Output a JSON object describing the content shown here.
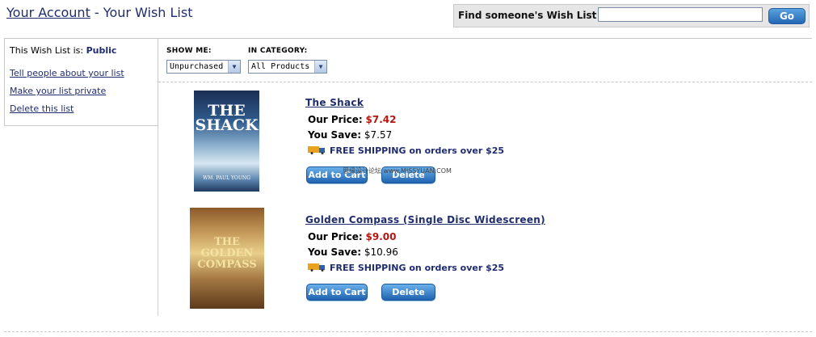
{
  "header": {
    "account_link": "Your Account",
    "separator": " - ",
    "page_title": "Your Wish List",
    "find_label": "Find someone's Wish List",
    "find_input_value": "",
    "go_button": "Go"
  },
  "left_panel": {
    "status_prefix": "This Wish List is:",
    "status_value": "Public",
    "links": [
      "Tell people about your list",
      "Make your list private",
      "Delete this list"
    ]
  },
  "filters": {
    "show_me_label": "SHOW ME:",
    "show_me_value": "Unpurchased",
    "category_label": "IN CATEGORY:",
    "category_value": "All Products"
  },
  "items": [
    {
      "title": "The Shack",
      "our_price_label": "Our Price:",
      "our_price": "$7.42",
      "you_save_label": "You Save:",
      "you_save": "$7.57",
      "shipping": "FREE SHIPPING on orders over $25",
      "add_to_cart": "Add to Cart",
      "delete": "Delete",
      "cover_text": "THE SHACK",
      "cover_author": "WM. PAUL YOUNG"
    },
    {
      "title": "Golden Compass (Single Disc Widescreen)",
      "our_price_label": "Our Price:",
      "our_price": "$9.00",
      "you_save_label": "You Save:",
      "you_save": "$10.96",
      "shipping": "FREE SHIPPING on orders over $25",
      "add_to_cart": "Add to Cart",
      "delete": "Delete",
      "cover_text": "THE GOLDEN COMPASS"
    }
  ],
  "watermark": "思缘设计论坛 www.MISSYUAN.COM",
  "icons": {
    "dropdown": "chevron-down-icon",
    "truck": "truck-icon"
  }
}
